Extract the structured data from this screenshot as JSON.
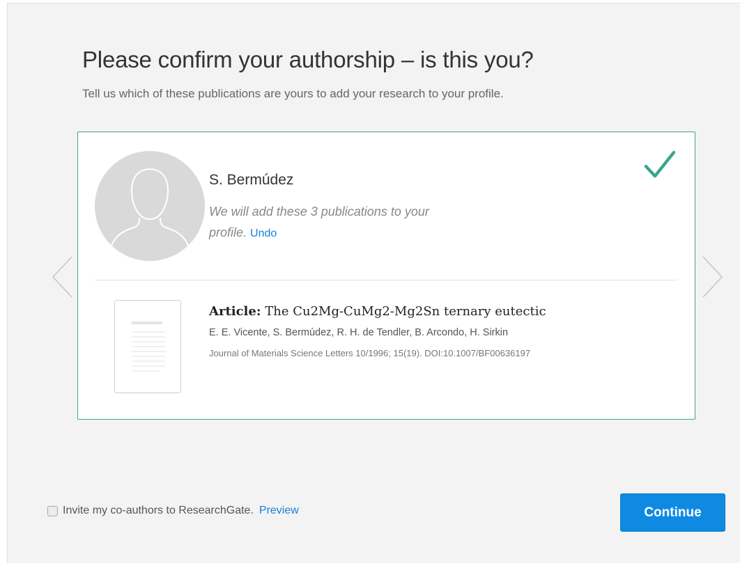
{
  "header": {
    "title": "Please confirm your authorship – is this you?",
    "subtitle": "Tell us which of these publications are yours to add your research to your profile."
  },
  "author": {
    "name": "S. Bermúdez",
    "message": "We will add these 3 publications to your profile.",
    "undo_label": "Undo",
    "avatar_icon": "default-user-silhouette-icon",
    "selected_icon": "checkmark-icon"
  },
  "publication": {
    "type_label": "Article:",
    "title": "The Cu2Mg-CuMg2-Mg2Sn ternary eutectic",
    "authors": "E. E. Vicente, S. Bermúdez, R. H. de Tendler, B. Arcondo, H. Sirkin",
    "journal": "Journal of Materials Science Letters 10/1996; 15(19). DOI:10.1007/BF00636197",
    "thumbnail_icon": "document-thumbnail-icon"
  },
  "navigation": {
    "prev_icon": "chevron-left-icon",
    "next_icon": "chevron-right-icon"
  },
  "footer": {
    "invite_label": "Invite my co-authors to ResearchGate.",
    "invite_checked": false,
    "preview_label": "Preview",
    "continue_label": "Continue"
  },
  "colors": {
    "accent_green": "#3aa58e",
    "link_blue": "#1a7fd6",
    "button_blue": "#0e8ae3",
    "background": "#f3f3f3"
  }
}
